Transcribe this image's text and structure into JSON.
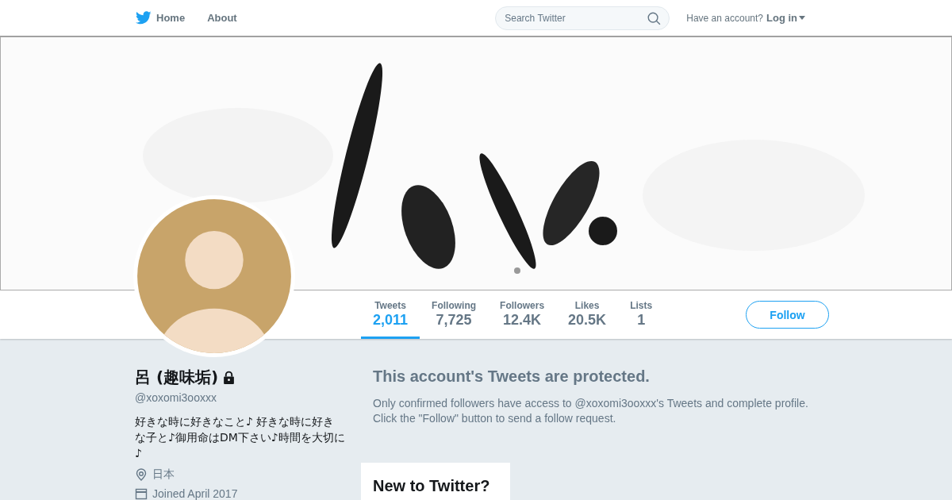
{
  "nav": {
    "links": [
      {
        "label": "Home"
      },
      {
        "label": "About"
      }
    ],
    "search": {
      "placeholder": "Search Twitter"
    },
    "account_prompt": "Have an account?",
    "login": "Log in"
  },
  "stats": [
    {
      "label": "Tweets",
      "value": "2,011",
      "selected": true
    },
    {
      "label": "Following",
      "value": "7,725",
      "selected": false
    },
    {
      "label": "Followers",
      "value": "12.4K",
      "selected": false
    },
    {
      "label": "Likes",
      "value": "20.5K",
      "selected": false
    },
    {
      "label": "Lists",
      "value": "1",
      "selected": false
    }
  ],
  "follow_button": "Follow",
  "profile": {
    "name": "呂 (趣味垢)",
    "protected": true,
    "handle": "@xoxomi3ooxxx",
    "bio": "好きな時に好きなこと♪ 好きな時に好きな子と♪御用命はDM下さい♪時間を大切に♪",
    "location": "日本",
    "joined": "Joined April 2017"
  },
  "protected_notice": {
    "title": "This account's Tweets are protected.",
    "body": "Only confirmed followers have access to @xoxomi3ooxxx's Tweets and complete profile. Click the \"Follow\" button to send a follow request."
  },
  "signup_card": {
    "title": "New to Twitter?"
  }
}
